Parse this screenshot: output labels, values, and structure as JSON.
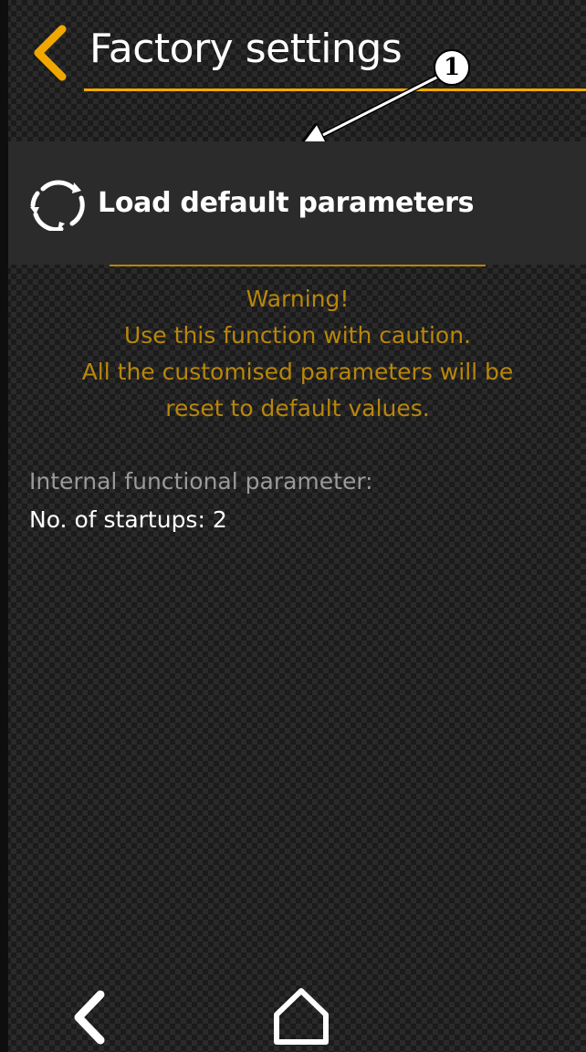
{
  "header": {
    "title": "Factory settings",
    "back_icon": "chevron-left-icon"
  },
  "callout": {
    "number": "1"
  },
  "action": {
    "label": "Load default parameters",
    "icon": "refresh-icon"
  },
  "warning": {
    "lines": [
      "Warning!",
      "Use this function with caution.",
      "All the customised parameters will be",
      "reset to default values."
    ]
  },
  "info": {
    "label": "Internal functional parameter:",
    "startups": "No. of startups: 2"
  },
  "nav": {
    "back_icon": "chevron-left-icon",
    "home_icon": "home-icon"
  },
  "colors": {
    "accent": "#f0a800",
    "warning_text": "#b8860b",
    "row_background": "#2b2b2b",
    "primary_text": "#ffffff",
    "secondary_text": "#9a9a9a"
  }
}
